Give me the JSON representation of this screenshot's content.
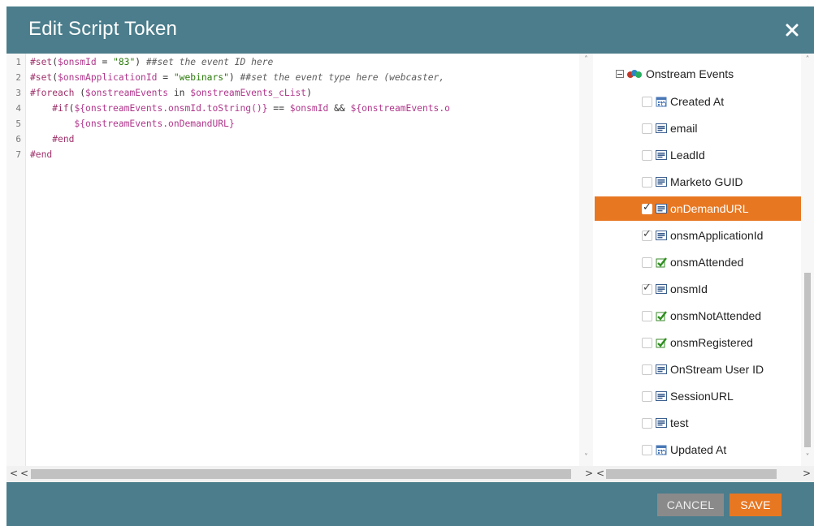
{
  "dialog": {
    "title": "Edit Script Token",
    "close_icon": "close-icon"
  },
  "editor": {
    "line_numbers": [
      "1",
      "2",
      "3",
      "4",
      "5",
      "6",
      "7"
    ],
    "lines": [
      [
        [
          "kw",
          "#set"
        ],
        [
          "pl",
          "("
        ],
        [
          "vr",
          "$onsmId"
        ],
        [
          "pl",
          " = "
        ],
        [
          "st",
          "\"83\""
        ],
        [
          "pl",
          ") "
        ],
        [
          "cm",
          "##set the event ID here"
        ]
      ],
      [
        [
          "kw",
          "#set"
        ],
        [
          "pl",
          "("
        ],
        [
          "vr",
          "$onsmApplicationId"
        ],
        [
          "pl",
          " = "
        ],
        [
          "st",
          "\"webinars\""
        ],
        [
          "pl",
          ") "
        ],
        [
          "cm",
          "##set the event type here (webcaster,"
        ]
      ],
      [
        [
          "kw",
          "#foreach"
        ],
        [
          "pl",
          " ("
        ],
        [
          "vr",
          "$onstreamEvents"
        ],
        [
          "pl",
          " in "
        ],
        [
          "vr",
          "$onstreamEvents_cList"
        ],
        [
          "pl",
          ")"
        ]
      ],
      [
        [
          "pl",
          "    "
        ],
        [
          "kw",
          "#if"
        ],
        [
          "pl",
          "("
        ],
        [
          "vr",
          "${onstreamEvents.onsmId.toString()}"
        ],
        [
          "pl",
          " == "
        ],
        [
          "vr",
          "$onsmId"
        ],
        [
          "pl",
          " && "
        ],
        [
          "vr",
          "${onstreamEvents.o"
        ]
      ],
      [
        [
          "pl",
          "        "
        ],
        [
          "vr",
          "${onstreamEvents.onDemandURL}"
        ]
      ],
      [
        [
          "pl",
          "    "
        ],
        [
          "kw",
          "#end"
        ]
      ],
      [
        [
          "kw",
          "#end"
        ]
      ]
    ]
  },
  "tree": {
    "root_label": "Onstream Events",
    "root_icon": "custom-object-icon",
    "items": [
      {
        "label": "Created At",
        "checked": false,
        "selected": false,
        "icon": "calendar-icon"
      },
      {
        "label": "email",
        "checked": false,
        "selected": false,
        "icon": "text-field-icon"
      },
      {
        "label": "LeadId",
        "checked": false,
        "selected": false,
        "icon": "text-field-icon"
      },
      {
        "label": "Marketo GUID",
        "checked": false,
        "selected": false,
        "icon": "text-field-icon"
      },
      {
        "label": "onDemandURL",
        "checked": true,
        "selected": true,
        "icon": "text-field-icon"
      },
      {
        "label": "onsmApplicationId",
        "checked": true,
        "selected": false,
        "icon": "text-field-icon"
      },
      {
        "label": "onsmAttended",
        "checked": false,
        "selected": false,
        "icon": "boolean-check-icon"
      },
      {
        "label": "onsmId",
        "checked": true,
        "selected": false,
        "icon": "text-field-icon"
      },
      {
        "label": "onsmNotAttended",
        "checked": false,
        "selected": false,
        "icon": "boolean-check-icon"
      },
      {
        "label": "onsmRegistered",
        "checked": false,
        "selected": false,
        "icon": "boolean-check-icon"
      },
      {
        "label": "OnStream User ID",
        "checked": false,
        "selected": false,
        "icon": "text-field-icon"
      },
      {
        "label": "SessionURL",
        "checked": false,
        "selected": false,
        "icon": "text-field-icon"
      },
      {
        "label": "test",
        "checked": false,
        "selected": false,
        "icon": "text-field-icon"
      },
      {
        "label": "Updated At",
        "checked": false,
        "selected": false,
        "icon": "calendar-icon"
      }
    ]
  },
  "footer": {
    "cancel_label": "CANCEL",
    "save_label": "SAVE"
  },
  "colors": {
    "header_bg": "#4b7d8c",
    "accent_orange": "#e87722",
    "cancel_gray": "#8a8a8a"
  }
}
